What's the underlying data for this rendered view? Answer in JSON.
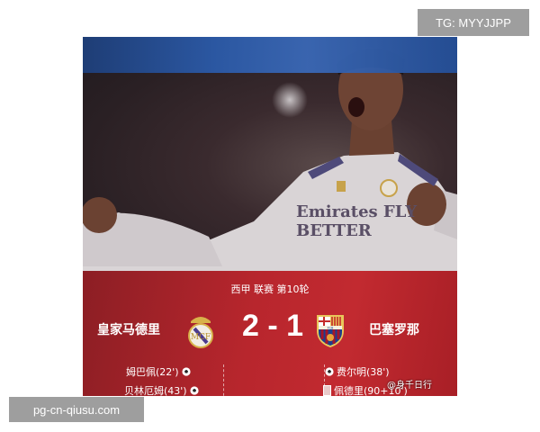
{
  "watermark_top": "TG: MYYJJPP",
  "watermark_bottom": "pg-cn-qiusu.com",
  "card": {
    "league_line": "西甲 联赛 第10轮",
    "home_team": "皇家马德里",
    "away_team": "巴塞罗那",
    "score": "2 - 1",
    "home_events": [
      {
        "text": "姆巴佩(22')",
        "icon": "football-icon"
      },
      {
        "text": "贝林厄姆(43')",
        "icon": "football-icon"
      }
    ],
    "away_events": [
      {
        "text": "费尔明(38')",
        "icon": "football-icon"
      },
      {
        "text": "佩德里(90+10')",
        "icon": "red-card-icon"
      }
    ],
    "credit": "@身千日行",
    "jersey_text": "Emirates FLY BETTER",
    "colors": {
      "home_crest_gold": "#d8b24a",
      "away_crest_blue": "#1b3f8f",
      "away_crest_red": "#a3172a",
      "banner_red": "#b8262d"
    }
  }
}
